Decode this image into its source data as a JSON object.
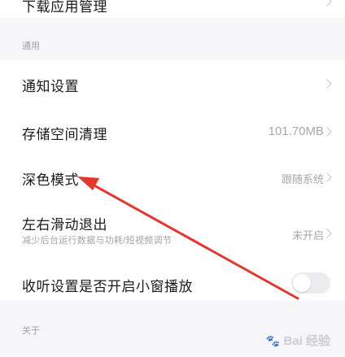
{
  "rows": {
    "download_manager": {
      "label": "下载应用管理"
    },
    "notifications": {
      "label": "通知设置"
    },
    "storage_cleanup": {
      "label": "存储空间清理",
      "value": "101.70MB"
    },
    "dark_mode": {
      "label": "深色模式",
      "value": "跟随系统"
    },
    "swipe_exit": {
      "label": "左右滑动退出",
      "value": "未开启",
      "sublabel": "减少后台运行数据与功耗/短视频调节"
    },
    "listen_setting": {
      "label": "收听设置是否开启小窗播放"
    }
  },
  "sections": {
    "general": "通用",
    "about": "关于"
  },
  "watermark": {
    "text": "Bai 经验",
    "paw": "🐾"
  },
  "colors": {
    "annotation_arrow": "#e8352e",
    "background": "#f6f6f8"
  }
}
